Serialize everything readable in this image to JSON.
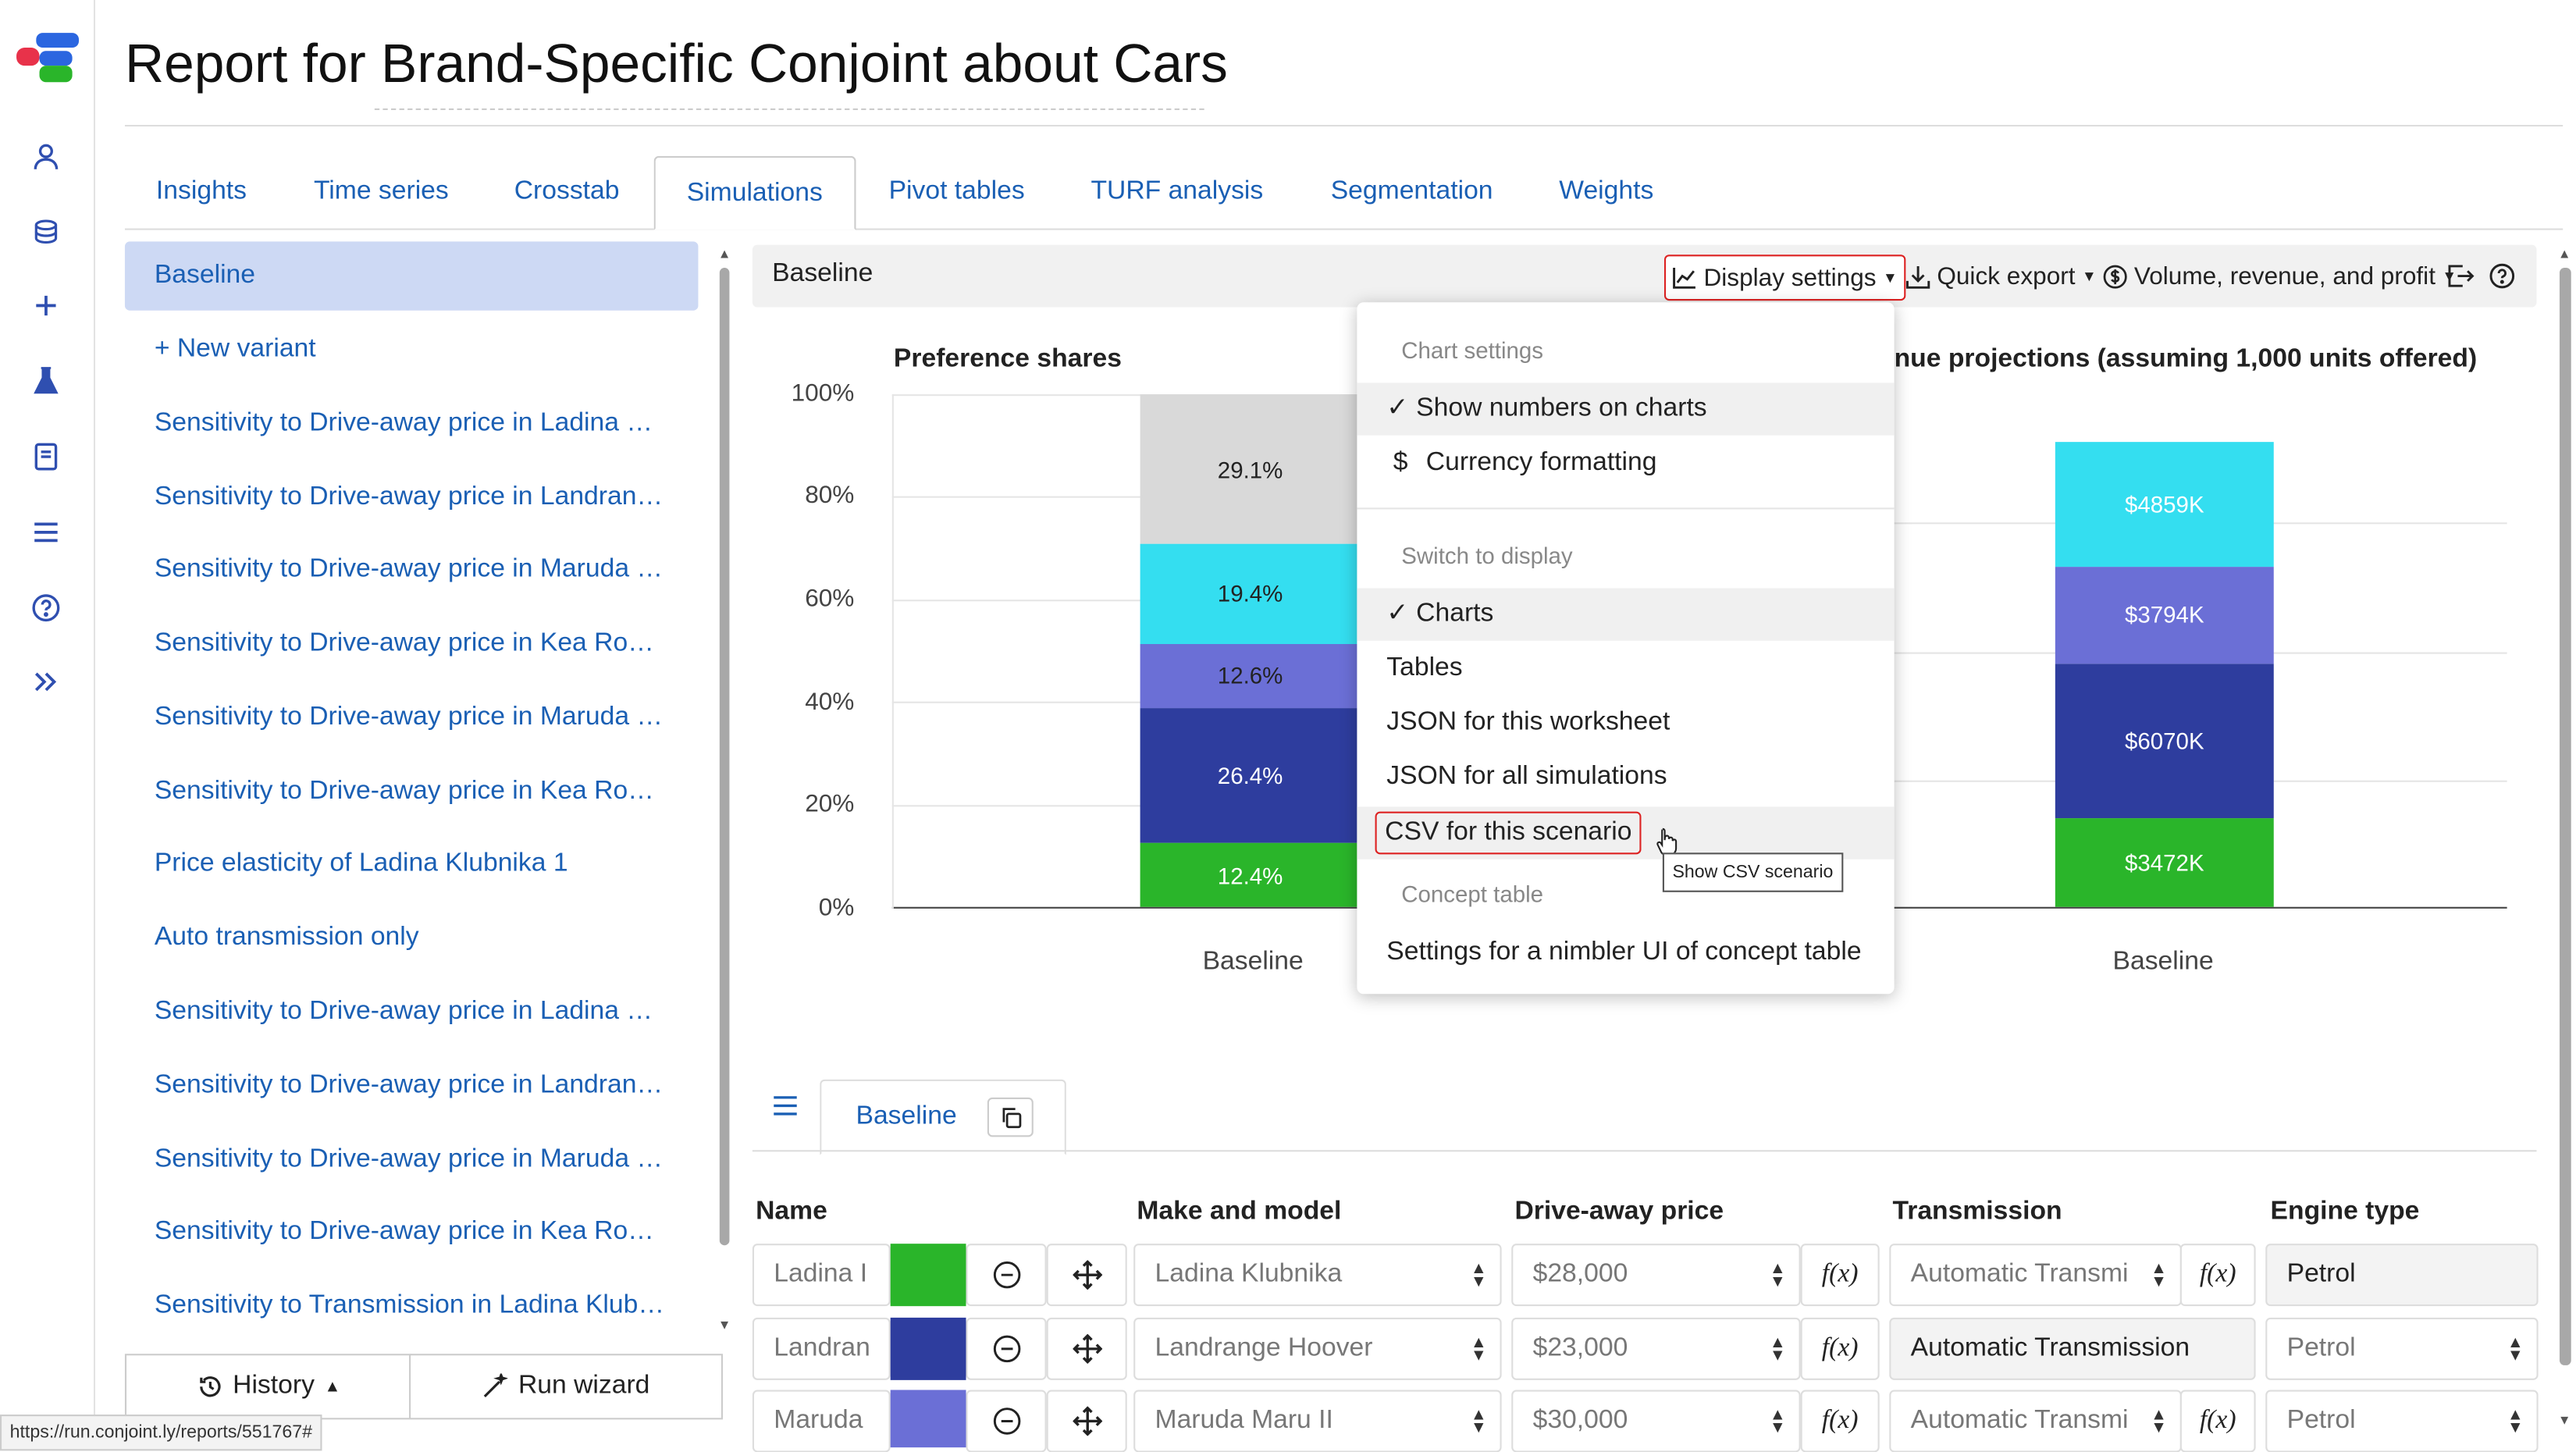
{
  "page": {
    "title": "Report for Brand-Specific Conjoint about Cars",
    "status_url": "https://run.conjoint.ly/reports/551767#"
  },
  "tabs": [
    "Insights",
    "Time series",
    "Crosstab",
    "Simulations",
    "Pivot tables",
    "TURF analysis",
    "Segmentation",
    "Weights"
  ],
  "sidebar": {
    "items": [
      "Baseline",
      "+ New variant",
      "Sensitivity to Drive-away price in Ladina …",
      "Sensitivity to Drive-away price in Landran…",
      "Sensitivity to Drive-away price in Maruda …",
      "Sensitivity to Drive-away price in Kea Ro…",
      "Sensitivity to Drive-away price in Maruda …",
      "Sensitivity to Drive-away price in Kea Ro…",
      "Price elasticity of Ladina Klubnika 1",
      "Auto transmission only",
      "Sensitivity to Drive-away price in Ladina …",
      "Sensitivity to Drive-away price in Landran…",
      "Sensitivity to Drive-away price in Maruda …",
      "Sensitivity to Drive-away price in Kea Ro…",
      "Sensitivity to Transmission in Ladina Klub…"
    ],
    "history_label": "History",
    "wizard_label": "Run wizard"
  },
  "header": {
    "title": "Baseline",
    "display_settings": "Display settings",
    "quick_export": "Quick export",
    "metric": "Volume, revenue, and profit"
  },
  "dropdown": {
    "chart_settings_head": "Chart settings",
    "show_numbers": "Show numbers on charts",
    "currency": "Currency formatting",
    "switch_head": "Switch to display",
    "charts": "Charts",
    "tables": "Tables",
    "json_worksheet": "JSON for this worksheet",
    "json_all": "JSON for all simulations",
    "csv_scenario": "CSV for this scenario",
    "concept_head": "Concept table",
    "nimbler": "Settings for a nimbler UI of concept table",
    "tooltip": "Show CSV scenario"
  },
  "chart_data": [
    {
      "type": "bar",
      "title": "Preference shares",
      "categories": [
        "Baseline"
      ],
      "ylim": [
        0,
        100
      ],
      "yticks": [
        "0%",
        "20%",
        "40%",
        "60%",
        "80%",
        "100%"
      ],
      "series": [
        {
          "values": [
            12.4
          ],
          "color": "#2ab52a",
          "label": "12.4%"
        },
        {
          "values": [
            26.4
          ],
          "color": "#2e3d9e",
          "label": "26.4%"
        },
        {
          "values": [
            12.6
          ],
          "color": "#6b6fd6",
          "label": "12.6%"
        },
        {
          "values": [
            19.4
          ],
          "color": "#34def0",
          "label": "19.4%"
        },
        {
          "values": [
            29.1
          ],
          "color": "#d9d9d9",
          "label": "29.1%"
        }
      ]
    },
    {
      "type": "bar",
      "title": "nue projections (assuming 1,000 units offered)",
      "categories": [
        "Baseline"
      ],
      "series": [
        {
          "values": [
            3472
          ],
          "color": "#2ab52a",
          "label": "$3472K"
        },
        {
          "values": [
            6070
          ],
          "color": "#2e3d9e",
          "label": "$6070K"
        },
        {
          "values": [
            3794
          ],
          "color": "#6b6fd6",
          "label": "$3794K"
        },
        {
          "values": [
            4859
          ],
          "color": "#34def0",
          "label": "$4859K"
        }
      ]
    }
  ],
  "concept": {
    "tab_label": "Baseline",
    "columns": [
      "Name",
      "Make and model",
      "Drive-away price",
      "Transmission",
      "Engine type"
    ],
    "rows": [
      {
        "name": "Ladina I",
        "color": "#2ab52a",
        "model": "Ladina Klubnika",
        "price": "$28,000",
        "transmission": "Automatic Transmi",
        "engine": "Petrol"
      },
      {
        "name": "Landran",
        "color": "#2e3d9e",
        "model": "Landrange Hoover",
        "price": "$23,000",
        "transmission": "Automatic Transmission",
        "engine": "Petrol"
      },
      {
        "name": "Maruda",
        "color": "#6b6fd6",
        "model": "Maruda Maru II",
        "price": "$30,000",
        "transmission": "Automatic Transmi",
        "engine": "Petrol"
      }
    ],
    "fx_label": "f(x)"
  }
}
